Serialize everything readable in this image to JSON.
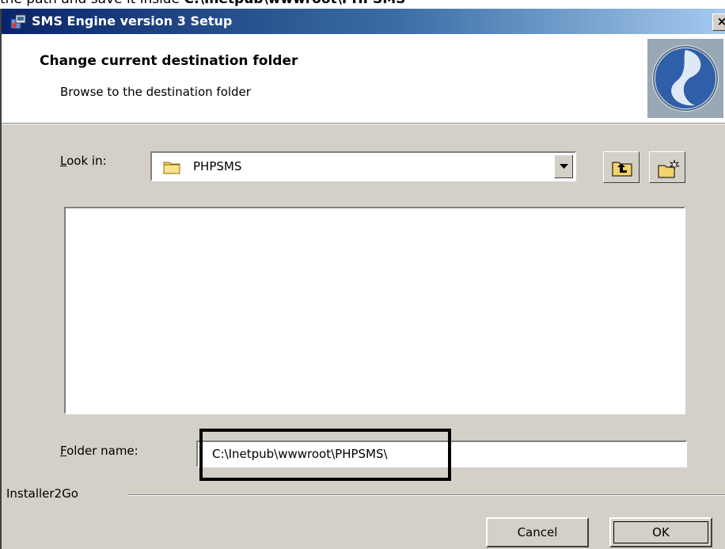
{
  "caption": {
    "prefix": "the path and save it inside",
    "bold_path": "C:\\Inetpub\\wwwroot\\PHPSMS"
  },
  "window": {
    "title": "SMS Engine version 3 Setup",
    "close_label": "×",
    "title_icon": "installer-icon"
  },
  "header": {
    "title": "Change current destination folder",
    "subtitle": "Browse to the destination folder",
    "logo_icon": "sms-engine-logo"
  },
  "look_in": {
    "label_first": "L",
    "label_rest": "ook in:",
    "value": "PHPSMS",
    "up_folder_icon": "up-one-level-icon",
    "new_folder_icon": "create-new-folder-icon"
  },
  "folder_name": {
    "label_first": "F",
    "label_rest": "older name:",
    "value": "C:\\Inetpub\\wwwroot\\PHPSMS\\"
  },
  "footer": {
    "brand": "Installer2Go",
    "cancel_label": "Cancel",
    "ok_label": "OK"
  },
  "colors": {
    "titlebar_start": "#0a246a",
    "titlebar_end": "#a6caf0",
    "dialog_face": "#d4d0c8",
    "highlight_box": "#000000"
  }
}
